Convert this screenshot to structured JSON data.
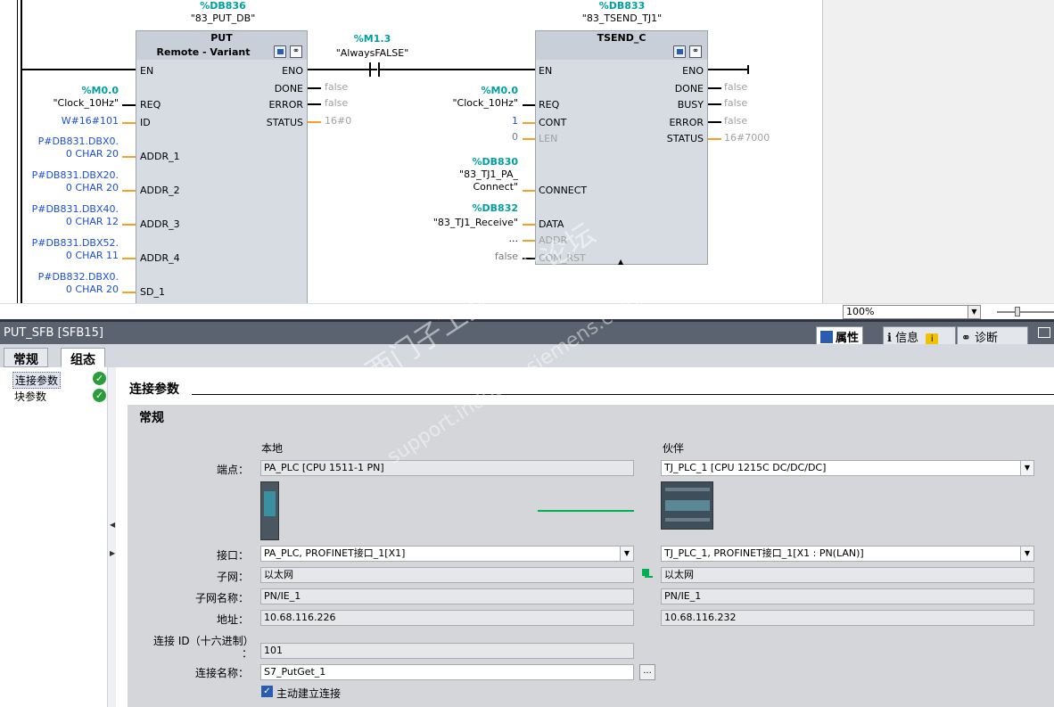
{
  "ladder": {
    "put": {
      "db_addr": "%DB836",
      "db_name": "\"83_PUT_DB\"",
      "title": "PUT",
      "subtitle": "Remote  - Variant",
      "inputs": {
        "en": "EN",
        "req": "REQ",
        "id": "ID",
        "addr1": "ADDR_1",
        "addr2": "ADDR_2",
        "addr3": "ADDR_3",
        "addr4": "ADDR_4",
        "sd1": "SD_1"
      },
      "outputs": {
        "eno": "ENO",
        "done": "DONE",
        "error": "ERROR",
        "status": "STATUS"
      },
      "req_tag": "%M0.0",
      "req_val": "\"Clock_10Hz\"",
      "id_val": "W#16#101",
      "addr1_a": "P#DB831.DBX0.",
      "addr1_b": "0 CHAR 20",
      "addr2_a": "P#DB831.DBX20.",
      "addr2_b": "0 CHAR 20",
      "addr3_a": "P#DB831.DBX40.",
      "addr3_b": "0 CHAR 12",
      "addr4_a": "P#DB831.DBX52.",
      "addr4_b": "0 CHAR 11",
      "sd1_a": "P#DB832.DBX0.",
      "sd1_b": "0 CHAR 20",
      "done_val": "false",
      "error_val": "false",
      "status_val": "16#0"
    },
    "contact": {
      "tag": "%M1.3",
      "name": "\"AlwaysFALSE\""
    },
    "tsend": {
      "db_addr": "%DB833",
      "db_name": "\"83_TSEND_TJ1\"",
      "title": "TSEND_C",
      "inputs": {
        "en": "EN",
        "req": "REQ",
        "cont": "CONT",
        "len": "LEN",
        "connect": "CONNECT",
        "data": "DATA",
        "addr": "ADDR",
        "com_rst": "COM_RST"
      },
      "outputs": {
        "eno": "ENO",
        "done": "DONE",
        "busy": "BUSY",
        "error": "ERROR",
        "status": "STATUS"
      },
      "req_tag": "%M0.0",
      "req_val": "\"Clock_10Hz\"",
      "cont_val": "1",
      "len_val": "0",
      "connect_tag": "%DB830",
      "connect_a": "\"83_TJ1_PA_",
      "connect_b": "Connect\"",
      "data_tag": "%DB832",
      "data_val": "\"83_TJ1_Receive\"",
      "addr_val": "...",
      "com_rst_val": "false",
      "done_val": "false",
      "busy_val": "false",
      "error_val": "false",
      "status_val": "16#7000"
    }
  },
  "zoom": {
    "value": "100%"
  },
  "props": {
    "title": "PUT_SFB [SFB15]",
    "tab_properties": "属性",
    "tab_info": "信息",
    "tab_diag": "诊断"
  },
  "subtabs": {
    "general": "常规",
    "config": "组态"
  },
  "nav": {
    "items": [
      {
        "label": "连接参数"
      },
      {
        "label": "块参数"
      }
    ]
  },
  "section": {
    "title": "连接参数",
    "subtitle": "常规"
  },
  "conn": {
    "local_header": "本地",
    "partner_header": "伙伴",
    "endpoint_label": "端点：",
    "local_endpoint": "PA_PLC [CPU 1511-1 PN]",
    "partner_endpoint": "TJ_PLC_1 [CPU 1215C DC/DC/DC]",
    "interface_label": "接口：",
    "local_interface": "PA_PLC, PROFINET接口_1[X1]",
    "partner_interface": "TJ_PLC_1, PROFINET接口_1[X1 : PN(LAN)]",
    "subnet_label": "子网：",
    "local_subnet": "以太网",
    "partner_subnet": "以太网",
    "subnet_name_label": "子网名称：",
    "local_subnet_name": "PN/IE_1",
    "partner_subnet_name": "PN/IE_1",
    "address_label": "地址：",
    "local_address": "10.68.116.226",
    "partner_address": "10.68.116.232",
    "conn_id_label": "连接 ID（十六进制）",
    "conn_id_colon": "：",
    "conn_id": "101",
    "conn_name_label": "连接名称：",
    "conn_name": "S7_PutGet_1",
    "browse": "...",
    "active_label": "主动建立连接"
  },
  "watermark": {
    "line1": "西门子工业  技术论坛",
    "line2": "support.industry.siemens.com/cs"
  }
}
